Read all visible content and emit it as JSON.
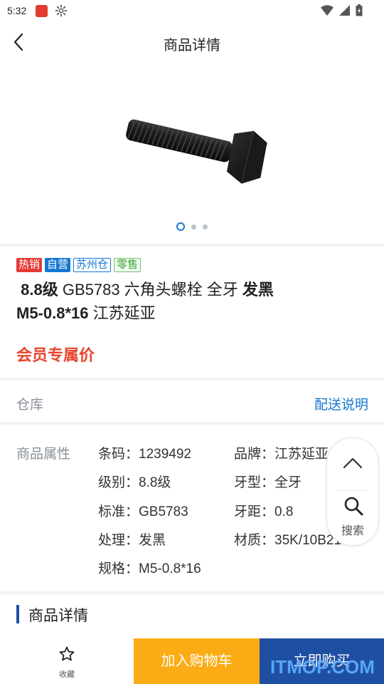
{
  "status": {
    "time": "5:32"
  },
  "header": {
    "title": "商品详情"
  },
  "gallery": {
    "image_count": 3,
    "active_index": 0
  },
  "product": {
    "tags": {
      "hot": "热销",
      "self": "自营",
      "warehouse": "苏州仓",
      "retail": "零售"
    },
    "title_seg1": "8.8级",
    "title_seg2": " GB5783 六角头螺栓 全牙 ",
    "title_seg3": "发黑",
    "title_seg4": "M5-0.8*16",
    "title_seg5": " 江苏延亚",
    "member_price_label": "会员专属价"
  },
  "warehouse": {
    "label": "仓库",
    "link": "配送说明"
  },
  "properties": {
    "label": "商品属性",
    "items": [
      {
        "key": "条码：",
        "value": "1239492"
      },
      {
        "key": "品牌：",
        "value": "江苏延亚"
      },
      {
        "key": "级别：",
        "value": "8.8级"
      },
      {
        "key": "牙型：",
        "value": "全牙"
      },
      {
        "key": "标准：",
        "value": "GB5783"
      },
      {
        "key": "牙距：",
        "value": "0.8"
      },
      {
        "key": "处理：",
        "value": "发黑"
      },
      {
        "key": "材质：",
        "value": "35K/10B21"
      },
      {
        "key": "规格：",
        "value": "M5-0.8*16"
      }
    ]
  },
  "floating": {
    "search_label": "搜索"
  },
  "details": {
    "title": "商品详情"
  },
  "bottom": {
    "favorite_label": "收藏",
    "add_to_cart": "加入购物车",
    "buy_now": "立即购买"
  },
  "watermark": "ITMOP.COM",
  "colors": {
    "accent_blue": "#1677d2",
    "buy_blue": "#1f4fa3",
    "cart_orange": "#fbac15",
    "price_red": "#e8452e"
  }
}
